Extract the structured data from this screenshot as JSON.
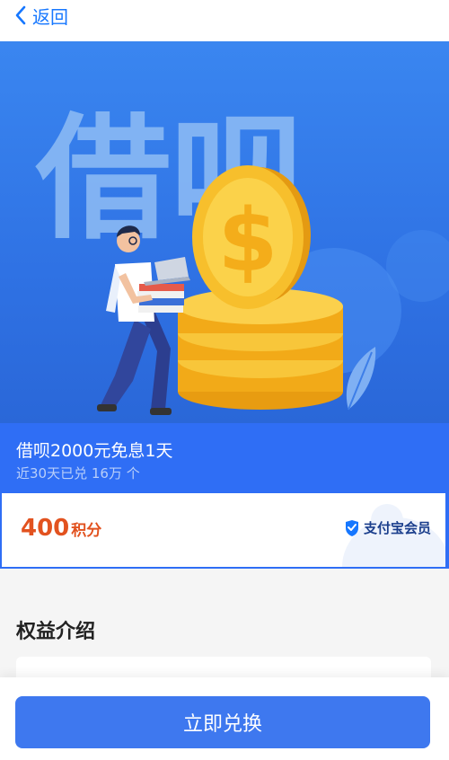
{
  "nav": {
    "back_label": "返回"
  },
  "hero": {
    "logo_text": "借呗",
    "coin_symbol": "$"
  },
  "product": {
    "title": "借呗2000元免息1天",
    "redeemed_text": "近30天已兑 16万 个"
  },
  "points": {
    "value": "400",
    "unit": "积分"
  },
  "brand": {
    "label": "支付宝会员"
  },
  "section": {
    "title": "权益介绍"
  },
  "actions": {
    "redeem_label": "立即兑换"
  },
  "colors": {
    "accent": "#1677ff",
    "cta": "#3e78ef",
    "info_bg": "#2f6ef5",
    "points": "#e2521f",
    "coin": "#f5b820"
  }
}
